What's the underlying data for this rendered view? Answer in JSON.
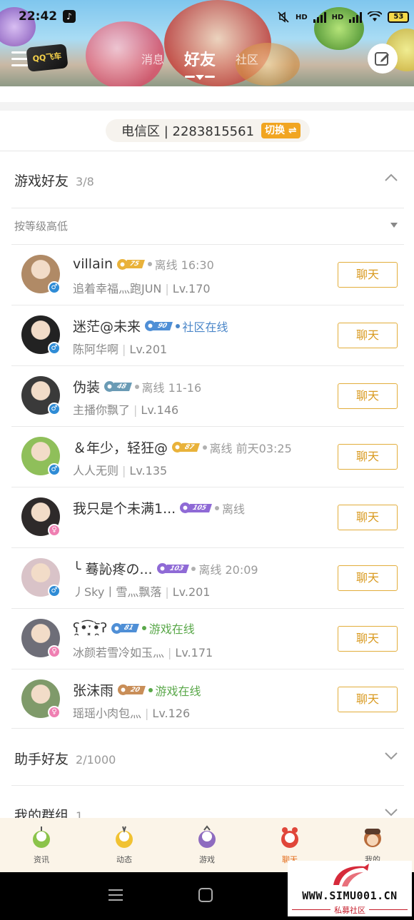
{
  "status_bar": {
    "time": "22:42",
    "tiktok_icon": "♪",
    "hd1": "HD",
    "hd2": "HD",
    "battery": "53"
  },
  "header": {
    "logo_text": "QQ飞车",
    "tabs": [
      {
        "label": "消息"
      },
      {
        "label": "好友"
      },
      {
        "label": "社区"
      }
    ]
  },
  "region": {
    "text": "电信区 | 2283815561",
    "switch_label": "切换 ⇌"
  },
  "game_friends": {
    "title": "游戏好友",
    "count": "3/8",
    "sort_label": "按等级高低",
    "friends": [
      {
        "name": "villain",
        "badge": "75",
        "badge_color": "#e9b23a",
        "status": "离线 16:30",
        "status_color": "#9a9a9a",
        "dot_color": "#b0b0b0",
        "sub": "追着幸福灬跑JUN",
        "level": "Lv.170",
        "gender": "male",
        "chat": "聊天",
        "avatar_color": "#b08a66"
      },
      {
        "name": "迷茫@未来",
        "badge": "90",
        "badge_color": "#4f8fd6",
        "status": "社区在线",
        "status_color": "#4a86c8",
        "dot_color": "#4a86c8",
        "sub": "陈阿华啊",
        "level": "Lv.201",
        "gender": "male",
        "chat": "聊天",
        "avatar_color": "#222222"
      },
      {
        "name": "伪装",
        "badge": "48",
        "badge_color": "#6a9bb5",
        "status": "离线 11-16",
        "status_color": "#9a9a9a",
        "dot_color": "#b0b0b0",
        "sub": "主播你飘了",
        "level": "Lv.146",
        "gender": "male",
        "chat": "聊天",
        "avatar_color": "#3a3a3a"
      },
      {
        "name": "＆年少，轻狂@",
        "badge": "87",
        "badge_color": "#e9b23a",
        "status": "离线 前天03:25",
        "status_color": "#9a9a9a",
        "dot_color": "#b0b0b0",
        "sub": "人人无则",
        "level": "Lv.135",
        "gender": "male",
        "chat": "聊天",
        "avatar_color": "#8fbf5a"
      },
      {
        "name": "我只是个未满1...",
        "badge": "105",
        "badge_color": "#8f6ad6",
        "status": "离线",
        "status_color": "#9a9a9a",
        "dot_color": "#b0b0b0",
        "sub": "",
        "level": "",
        "gender": "female",
        "chat": "聊天",
        "avatar_color": "#2e2a2a"
      },
      {
        "name": "╰ 蓦訫疼の...",
        "badge": "103",
        "badge_color": "#8f6ad6",
        "status": "离线 20:09",
        "status_color": "#9a9a9a",
        "dot_color": "#b0b0b0",
        "sub": "丿Sky丨雪灬飘落",
        "level": "Lv.201",
        "gender": "male",
        "chat": "聊天",
        "avatar_color": "#d9c3c8"
      },
      {
        "name": "ʕ̯•͡ˑ͓•̯᷅ʔ",
        "badge": "81",
        "badge_color": "#4f8fd6",
        "status": "游戏在线",
        "status_color": "#5aa84a",
        "dot_color": "#5aa84a",
        "sub": "冰颜若雪冷如玉灬",
        "level": "Lv.171",
        "gender": "female",
        "chat": "聊天",
        "avatar_color": "#6e6e78"
      },
      {
        "name": "张沫雨",
        "badge": "20",
        "badge_color": "#c98e58",
        "status": "游戏在线",
        "status_color": "#5aa84a",
        "dot_color": "#5aa84a",
        "sub": "瑶瑶小肉包灬",
        "level": "Lv.126",
        "gender": "female",
        "chat": "聊天",
        "avatar_color": "#7f9a6a"
      }
    ]
  },
  "assistant_friends": {
    "title": "助手好友",
    "count": "2/1000"
  },
  "my_groups": {
    "title": "我的群组",
    "count": "1"
  },
  "bottom_nav": [
    {
      "label": "资讯",
      "color": "#8bc34a"
    },
    {
      "label": "动态",
      "color": "#f1c232"
    },
    {
      "label": "游戏",
      "color": "#8e6bbf"
    },
    {
      "label": "聊天",
      "color": "#e0463a"
    },
    {
      "label": "我的",
      "color": "#b86b3a"
    }
  ],
  "watermark": {
    "url": "WWW.SIMU001.CN",
    "sub": "私募社区"
  }
}
